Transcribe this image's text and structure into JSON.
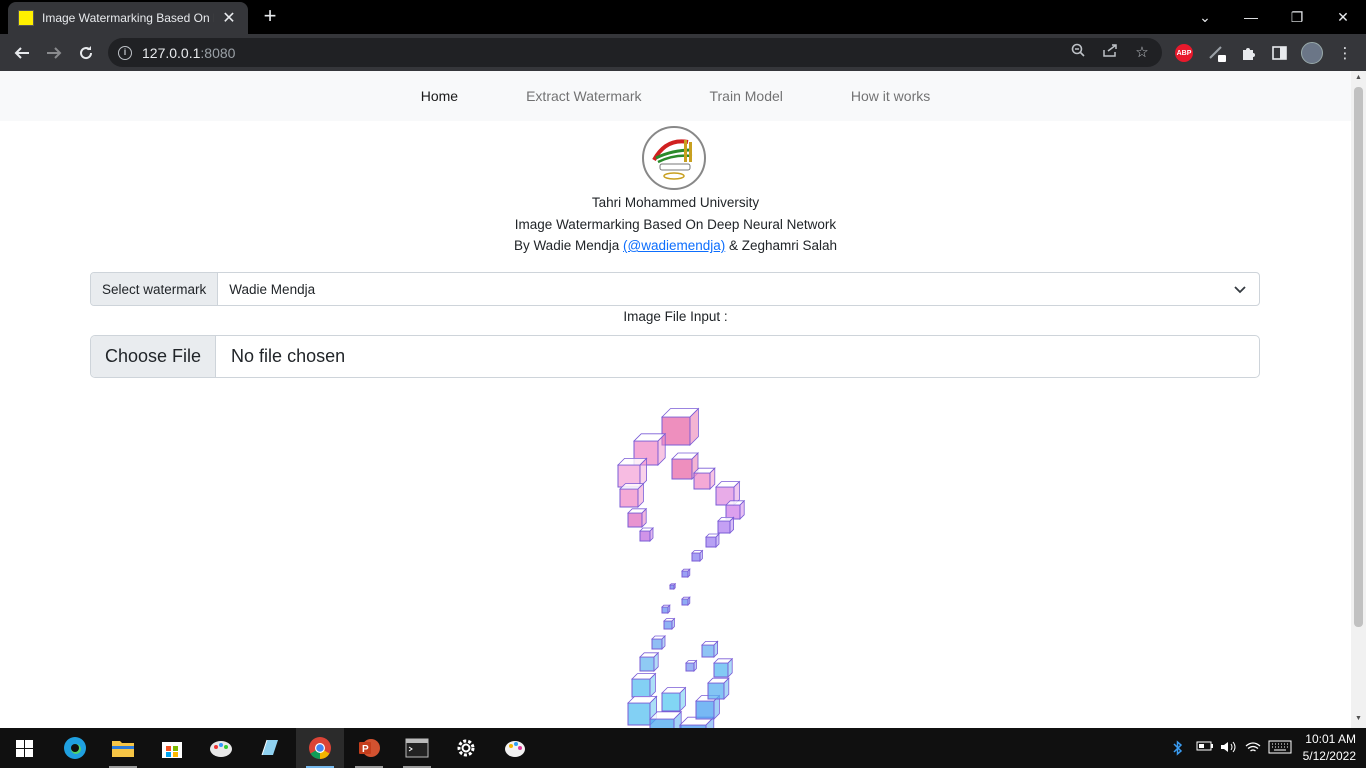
{
  "browser": {
    "tab_title": "Image Watermarking Based On D",
    "url_host": "127.0.0.1",
    "url_port": ":8080"
  },
  "navbar": {
    "links": [
      "Home",
      "Extract Watermark",
      "Train Model",
      "How it works"
    ]
  },
  "header": {
    "university": "Tahri Mohammed University",
    "project": "Image Watermarking Based On Deep Neural Network",
    "by_prefix": "By Wadie Mendja ",
    "handle": "(@wadiemendja)",
    "by_suffix": " & Zeghamri Salah"
  },
  "form": {
    "select_label": "Select watermark",
    "select_value": "Wadie Mendja",
    "file_label": "Image File Input :",
    "file_button": "Choose File",
    "file_status": "No file chosen"
  },
  "extensions": {
    "abp_label": "ABP"
  },
  "taskbar": {
    "time": "10:01 AM",
    "date": "5/12/2022"
  },
  "colors": {
    "link": "#0d6efd",
    "navbar_bg": "#f8f9fa",
    "chrome_dark": "#35363a"
  }
}
